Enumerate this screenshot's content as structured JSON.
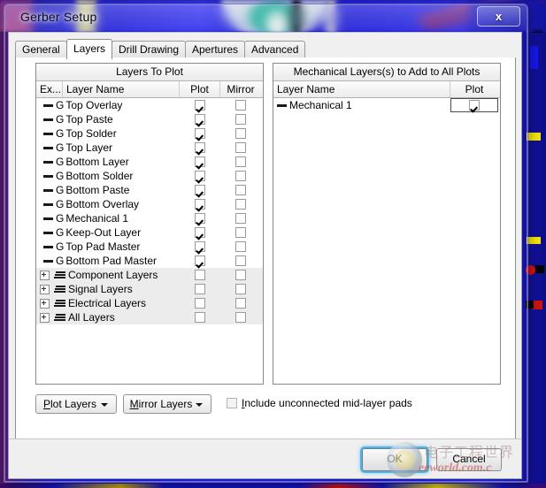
{
  "window": {
    "title": "Gerber Setup",
    "close_label": "x"
  },
  "tabs": [
    {
      "label": "General",
      "active": false
    },
    {
      "label": "Layers",
      "active": true
    },
    {
      "label": "Drill Drawing",
      "active": false
    },
    {
      "label": "Apertures",
      "active": false
    },
    {
      "label": "Advanced",
      "active": false
    }
  ],
  "left_grid": {
    "title": "Layers To Plot",
    "columns": [
      "Ex...",
      "Layer Name",
      "Plot",
      "Mirror"
    ],
    "rows": [
      {
        "type": "layer",
        "prefix": "G",
        "name": "Top Overlay",
        "plot": true,
        "mirror": false
      },
      {
        "type": "layer",
        "prefix": "G",
        "name": "Top Paste",
        "plot": true,
        "mirror": false
      },
      {
        "type": "layer",
        "prefix": "G",
        "name": "Top Solder",
        "plot": true,
        "mirror": false
      },
      {
        "type": "layer",
        "prefix": "G",
        "name": "Top Layer",
        "plot": true,
        "mirror": false
      },
      {
        "type": "layer",
        "prefix": "G",
        "name": "Bottom Layer",
        "plot": true,
        "mirror": false
      },
      {
        "type": "layer",
        "prefix": "G",
        "name": "Bottom Solder",
        "plot": true,
        "mirror": false
      },
      {
        "type": "layer",
        "prefix": "G",
        "name": "Bottom Paste",
        "plot": true,
        "mirror": false
      },
      {
        "type": "layer",
        "prefix": "G",
        "name": "Bottom Overlay",
        "plot": true,
        "mirror": false
      },
      {
        "type": "layer",
        "prefix": "G",
        "name": "Mechanical 1",
        "plot": true,
        "mirror": false
      },
      {
        "type": "layer",
        "prefix": "G",
        "name": "Keep-Out Layer",
        "plot": true,
        "mirror": false
      },
      {
        "type": "layer",
        "prefix": "G",
        "name": "Top Pad Master",
        "plot": true,
        "mirror": false
      },
      {
        "type": "layer",
        "prefix": "G",
        "name": "Bottom Pad Master",
        "plot": true,
        "mirror": false
      },
      {
        "type": "group",
        "prefix": "",
        "name": "Component Layers",
        "plot": false,
        "mirror": false
      },
      {
        "type": "group",
        "prefix": "",
        "name": "Signal Layers",
        "plot": false,
        "mirror": false
      },
      {
        "type": "group",
        "prefix": "",
        "name": "Electrical Layers",
        "plot": false,
        "mirror": false
      },
      {
        "type": "group",
        "prefix": "",
        "name": "All Layers",
        "plot": false,
        "mirror": false
      }
    ]
  },
  "right_grid": {
    "title": "Mechanical Layers(s) to Add to All Plots",
    "columns": [
      "Layer Name",
      "Plot"
    ],
    "rows": [
      {
        "name": "Mechanical 1",
        "plot": true,
        "focused": true
      }
    ]
  },
  "footer": {
    "plot_layers_button": "Plot Layers",
    "plot_layers_mnemonic": "P",
    "mirror_layers_button": "Mirror Layers",
    "mirror_layers_mnemonic": "M",
    "include_pads_label": "nclude unconnected mid-layer pads",
    "include_pads_mnemonic": "I",
    "include_pads_checked": false
  },
  "actions": {
    "ok": "OK",
    "cancel": "Cancel"
  },
  "watermark": {
    "chinese": "电子工程世界",
    "english": "eeworld.com.c"
  }
}
